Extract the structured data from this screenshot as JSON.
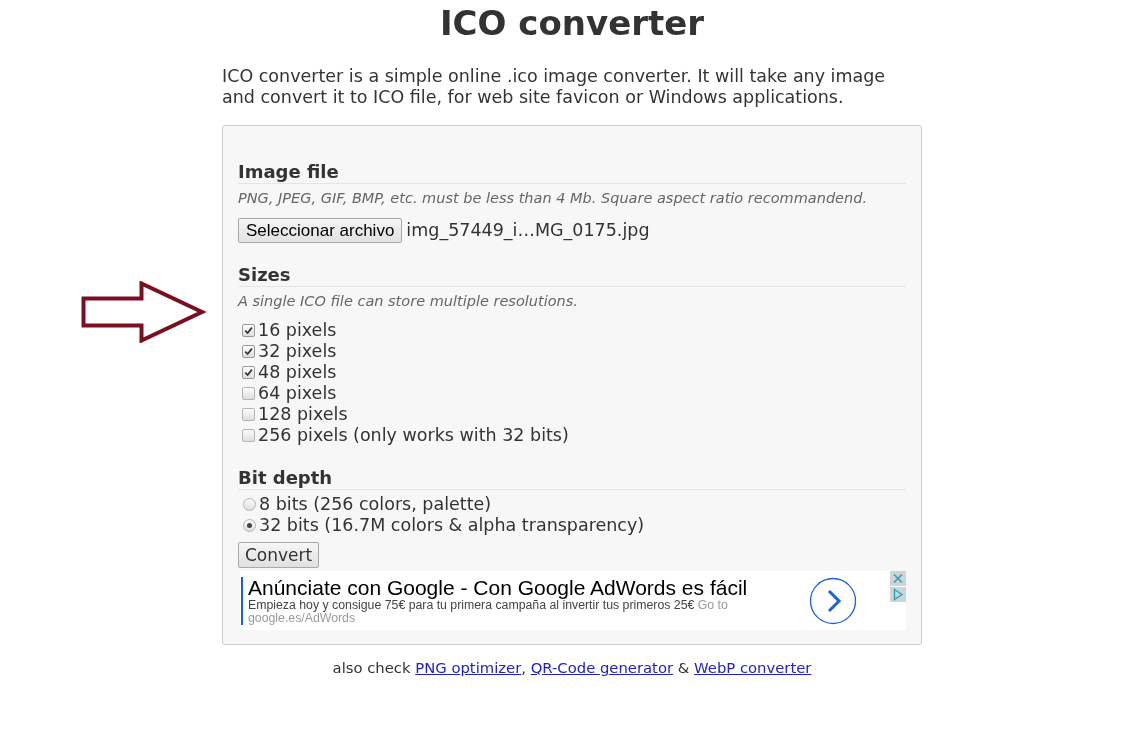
{
  "title": "ICO converter",
  "intro": "ICO converter is a simple online .ico image converter. It will take any image and convert it to ICO file, for web site favicon or Windows applications.",
  "image_file": {
    "heading": "Image file",
    "hint": "PNG, JPEG, GIF, BMP, etc. must be less than 4 Mb. Square aspect ratio recommandend.",
    "button": "Seleccionar archivo",
    "file_name": "img_57449_i…MG_0175.jpg"
  },
  "sizes": {
    "heading": "Sizes",
    "hint": "A single ICO file can store multiple resolutions.",
    "options": [
      {
        "label": "16 pixels",
        "checked": true
      },
      {
        "label": "32 pixels",
        "checked": true
      },
      {
        "label": "48 pixels",
        "checked": true
      },
      {
        "label": "64 pixels",
        "checked": false
      },
      {
        "label": "128 pixels",
        "checked": false
      },
      {
        "label": "256 pixels (only works with 32 bits)",
        "checked": false
      }
    ]
  },
  "bit_depth": {
    "heading": "Bit depth",
    "options": [
      {
        "label": "8 bits (256 colors, palette)",
        "selected": false
      },
      {
        "label": "32 bits (16.7M colors & alpha transparency)",
        "selected": true
      }
    ]
  },
  "convert_button": "Convert",
  "ad": {
    "headline": "Anúnciate con Google - Con Google AdWords es fácil",
    "description": "Empieza hoy y consigue 75€ para tu primera campaña al invertir tus primeros 25€",
    "link": "Go to google.es/AdWords"
  },
  "footer": {
    "parts": [
      {
        "kind": "text",
        "text": "also check"
      },
      {
        "kind": "link",
        "text": "PNG optimizer"
      },
      {
        "kind": "punct",
        "text": ","
      },
      {
        "kind": "link",
        "text": "QR-Code generator"
      },
      {
        "kind": "text",
        "text": "&"
      },
      {
        "kind": "link",
        "text": "WebP converter"
      }
    ]
  },
  "annotations": [
    {
      "kind": "arrow"
    }
  ]
}
